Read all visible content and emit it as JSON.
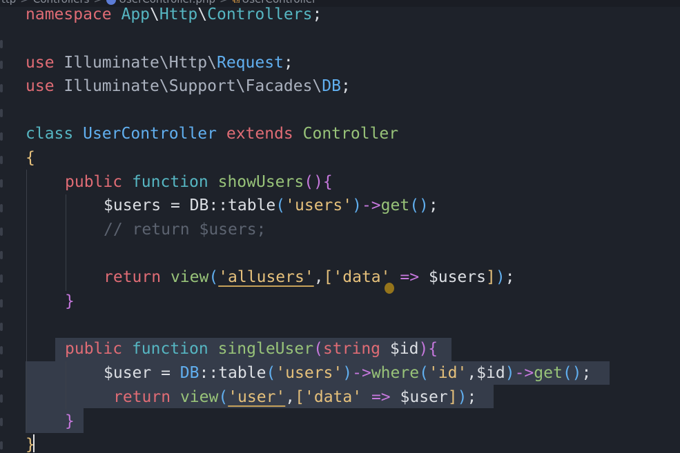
{
  "breadcrumb": {
    "part1": "ttp",
    "part2": "Controllers",
    "file": "UserController.php",
    "symbol": "UserController"
  },
  "colors": {
    "background": "#1e222a",
    "selection": "#353c4a",
    "keyword": "#e06c75",
    "keyword_function": "#56b6c2",
    "class_name": "#98c379",
    "string": "#e5c07b",
    "variable": "#d19a66",
    "comment": "#5c6370"
  },
  "code": {
    "l1": {
      "kw": "namespace",
      "ns1": "App",
      "sep1": "\\",
      "ns2": "Http",
      "sep2": "\\",
      "ns3": "Controllers",
      "end": ";"
    },
    "l3": {
      "kw": "use",
      "ns": "Illuminate\\Http\\",
      "cls": "Request",
      "end": ";"
    },
    "l4": {
      "kw": "use",
      "ns": "Illuminate\\Support\\Facades\\",
      "cls": "DB",
      "end": ";"
    },
    "l6": {
      "kw": "class",
      "name": "UserController",
      "ext": "extends",
      "parent": "Controller"
    },
    "l7": {
      "brace": "{"
    },
    "l8": {
      "vis": "public",
      "fn": "function",
      "name": "showUsers",
      "paren": "()",
      "brace": "{"
    },
    "l9": {
      "var": "$users",
      "eq": " = ",
      "cls": "DB",
      "dc": "::",
      "m": "table",
      "p1": "(",
      "s": "'users'",
      "p2": ")",
      "arrow": "->",
      "m2": "get",
      "p3": "()",
      "end": ";"
    },
    "l10": {
      "comment": "// return $users;"
    },
    "l12": {
      "ret": "return",
      "fn": "view",
      "p1": "(",
      "s1": "'allusers'",
      "comma": ",",
      "b1": "[",
      "s2": "'data'",
      "arr": " => ",
      "var": "$users",
      "b2": "]",
      "p2": ")",
      "end": ";"
    },
    "l13": {
      "brace": "}"
    },
    "l15": {
      "vis": "public",
      "fn": "function",
      "name": "singleUser",
      "p1": "(",
      "ty": "string",
      "var": "$id",
      "p2": ")",
      "brace": "{"
    },
    "l16": {
      "var": "$user",
      "eq": " = ",
      "cls": "DB",
      "dc": "::",
      "m": "table",
      "p1": "(",
      "s": "'users'",
      "p2": ")",
      "arrow": "->",
      "m2": "where",
      "p3": "(",
      "s2": "'id'",
      "comma": ",",
      "var2": "$id",
      "p4": ")",
      "arrow2": "->",
      "m3": "get",
      "p5": "()",
      "end": ";"
    },
    "l17": {
      "ret": "return",
      "fn": "view",
      "p1": "(",
      "s1": "'user'",
      "comma": ",",
      "b1": "[",
      "s2": "'data'",
      "arr": " => ",
      "var": "$user",
      "b2": "]",
      "p2": ")",
      "end": ";"
    },
    "l18": {
      "brace": "}"
    },
    "l19": {
      "brace": "}"
    }
  }
}
